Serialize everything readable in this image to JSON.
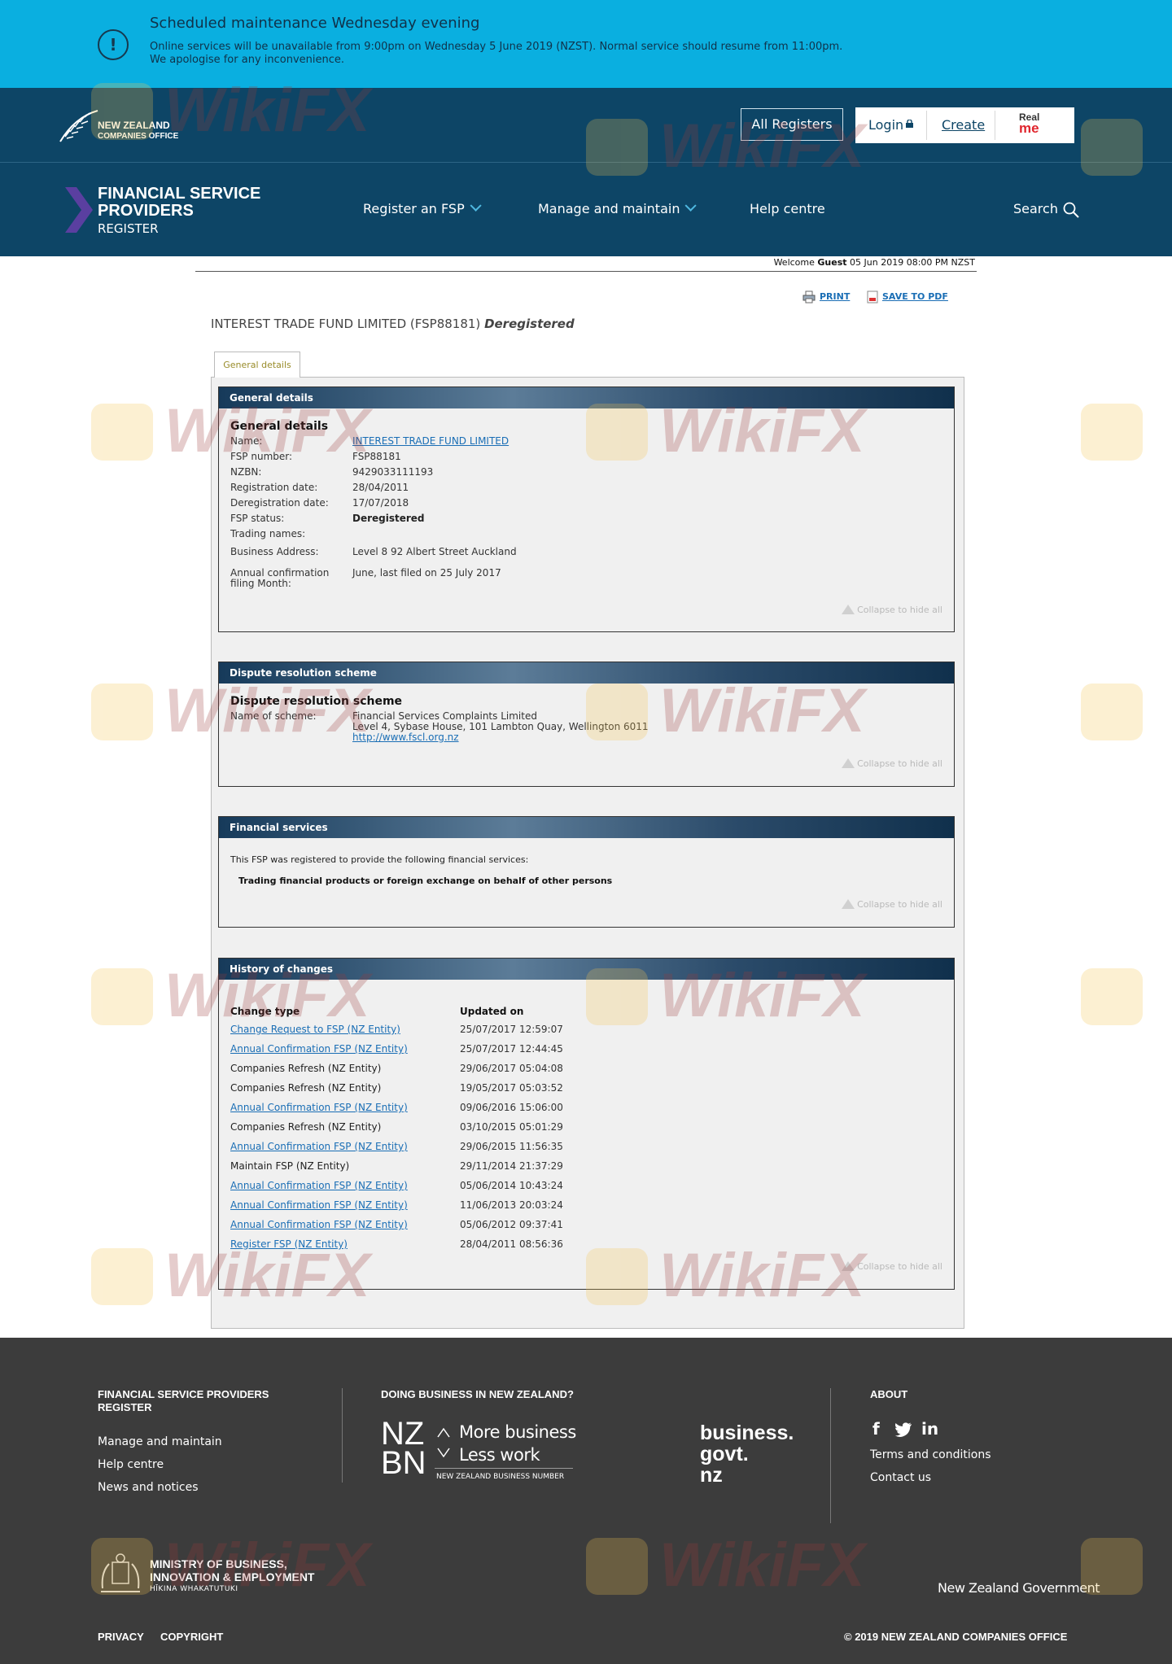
{
  "banner": {
    "icon": "alert-circle-icon",
    "title": "Scheduled maintenance Wednesday evening",
    "line1": "Online services will be unavailable from 9:00pm on Wednesday 5 June 2019 (NZST).  Normal service should resume from 11:00pm.",
    "line2": "We apologise for any inconvenience."
  },
  "header": {
    "logo_line1": "NEW ZEALAND",
    "logo_line2": "COMPANIES OFFICE",
    "all_registers": "All Registers",
    "login": "Login",
    "create": "Create",
    "realme_line1": "Real",
    "realme_line2": "me"
  },
  "site": {
    "title_line1": "FINANCIAL SERVICE",
    "title_line2": "PROVIDERS",
    "subtitle": "REGISTER"
  },
  "nav": {
    "items": [
      "Register an FSP",
      "Manage and maintain",
      "Help centre"
    ],
    "search": "Search"
  },
  "welcome": {
    "prefix": "Welcome",
    "user": "Guest",
    "datetime": "05 Jun 2019 08:00 PM NZST"
  },
  "tools": {
    "print": "PRINT",
    "save_pdf": "SAVE TO PDF"
  },
  "entity": {
    "name": "INTEREST TRADE FUND LIMITED (FSP88181)",
    "status": "Deregistered"
  },
  "tab": "General details",
  "collapse_label": "Collapse to hide all",
  "general": {
    "header": "General details",
    "subheader": "General details",
    "fields": [
      {
        "label": "Name:",
        "value": "INTEREST TRADE FUND LIMITED",
        "link": true
      },
      {
        "label": "FSP number:",
        "value": "FSP88181"
      },
      {
        "label": "NZBN:",
        "value": "9429033111193"
      },
      {
        "label": "Registration date:",
        "value": "28/04/2011"
      },
      {
        "label": "Deregistration date:",
        "value": "17/07/2018"
      },
      {
        "label": "FSP status:",
        "value": "Deregistered",
        "bold": true
      },
      {
        "label": "Trading names:",
        "value": ""
      },
      {
        "label": "Business Address:",
        "value": "Level 8 92 Albert Street Auckland"
      }
    ],
    "annual_label_line1": "Annual confirmation",
    "annual_label_line2": "filing Month:",
    "annual_value": "June, last filed on 25 July 2017"
  },
  "dispute": {
    "header": "Dispute resolution scheme",
    "subheader": "Dispute resolution scheme",
    "label": "Name of scheme:",
    "scheme_name": "Financial Services Complaints Limited",
    "scheme_address": "Level 4, Sybase House, 101 Lambton Quay, Wellington 6011",
    "scheme_url": "http://www.fscl.org.nz"
  },
  "services": {
    "header": "Financial services",
    "intro": "This FSP was registered to provide the following financial services:",
    "item": "Trading financial products or foreign exchange on behalf of other persons"
  },
  "history": {
    "header": "History of changes",
    "col_type": "Change type",
    "col_updated": "Updated on",
    "rows": [
      {
        "type": "Change Request to FSP (NZ Entity)",
        "date": "25/07/2017 12:59:07",
        "link": true
      },
      {
        "type": "Annual Confirmation FSP (NZ Entity)",
        "date": "25/07/2017 12:44:45",
        "link": true
      },
      {
        "type": "Companies Refresh (NZ Entity)",
        "date": "29/06/2017 05:04:08",
        "link": false
      },
      {
        "type": "Companies Refresh (NZ Entity)",
        "date": "19/05/2017 05:03:52",
        "link": false
      },
      {
        "type": "Annual Confirmation FSP (NZ Entity)",
        "date": "09/06/2016 15:06:00",
        "link": true
      },
      {
        "type": "Companies Refresh (NZ Entity)",
        "date": "03/10/2015 05:01:29",
        "link": false
      },
      {
        "type": "Annual Confirmation FSP (NZ Entity)",
        "date": "29/06/2015 11:56:35",
        "link": true
      },
      {
        "type": "Maintain FSP (NZ Entity)",
        "date": "29/11/2014 21:37:29",
        "link": false
      },
      {
        "type": "Annual Confirmation FSP (NZ Entity)",
        "date": "05/06/2014 10:43:24",
        "link": true
      },
      {
        "type": "Annual Confirmation FSP (NZ Entity)",
        "date": "11/06/2013 20:03:24",
        "link": true
      },
      {
        "type": "Annual Confirmation FSP (NZ Entity)",
        "date": "05/06/2012 09:37:41",
        "link": true
      },
      {
        "type": "Register FSP (NZ Entity)",
        "date": "28/04/2011 08:56:36",
        "link": true
      }
    ]
  },
  "footer": {
    "col1_title_line1": "FINANCIAL SERVICE PROVIDERS",
    "col1_title_line2": "REGISTER",
    "col1_links": [
      "Manage and maintain",
      "Help centre",
      "News and notices"
    ],
    "col2_title": "DOING BUSINESS IN NEW ZEALAND?",
    "nzbn_more": "More business",
    "nzbn_less": "Less work",
    "nzbn_caption": "NEW ZEALAND BUSINESS NUMBER",
    "bgn_line1": "business.",
    "bgn_line2": "govt.",
    "bgn_line3": "nz",
    "col3_title": "ABOUT",
    "col3_links": [
      "Terms and conditions",
      "Contact us"
    ],
    "mbie_line1": "MINISTRY OF BUSINESS,",
    "mbie_line2": "INNOVATION & EMPLOYMENT",
    "mbie_sub": "HĪKINA WHAKATUTUKI",
    "nzgov": "New Zealand Government",
    "privacy": "PRIVACY",
    "copyright": "COPYRIGHT",
    "copyright_notice": "© 2019 NEW ZEALAND COMPANIES OFFICE"
  },
  "watermark": "WikiFX",
  "colors": {
    "banner": "#0aafe0",
    "header": "#0d4566",
    "footer": "#3c3c3c",
    "link": "#1a6eb5",
    "accent_chevron": "#5a3fa0"
  }
}
